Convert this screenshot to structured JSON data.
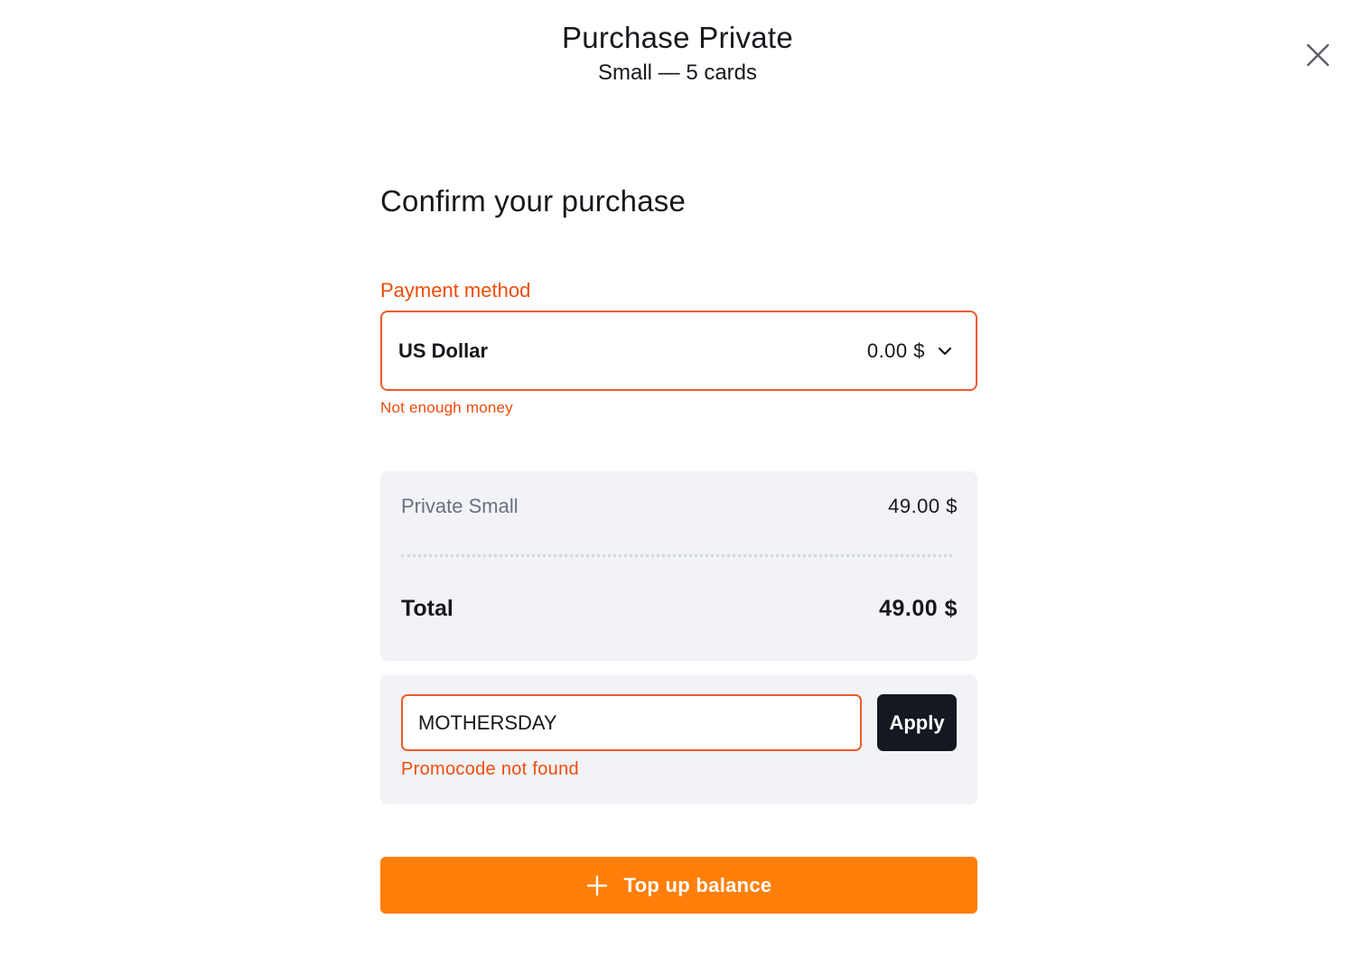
{
  "modal": {
    "title": "Purchase Private",
    "subtitle": "Small — 5 cards"
  },
  "icons": {
    "close": "close-icon",
    "dropdown": "chevron-down-icon",
    "add": "plus-icon"
  },
  "confirm": {
    "heading": "Confirm your purchase"
  },
  "payment_method": {
    "label": "Payment method",
    "selected_currency": "US Dollar",
    "balance": "0.00 $",
    "error": "Not enough money"
  },
  "summary": {
    "item_name": "Private Small",
    "item_price": "49.00 $",
    "total_label": "Total",
    "total_price": "49.00 $"
  },
  "promo": {
    "value": "MOTHERSDAY",
    "apply_label": "Apply",
    "error": "Promocode not found"
  },
  "actions": {
    "top_up_label": "Top up balance"
  },
  "colors": {
    "accent_orange": "#ff7f0a",
    "error_red": "#ef4c0b",
    "panel_bg": "#f2f3f7",
    "dark_button": "#141820"
  }
}
